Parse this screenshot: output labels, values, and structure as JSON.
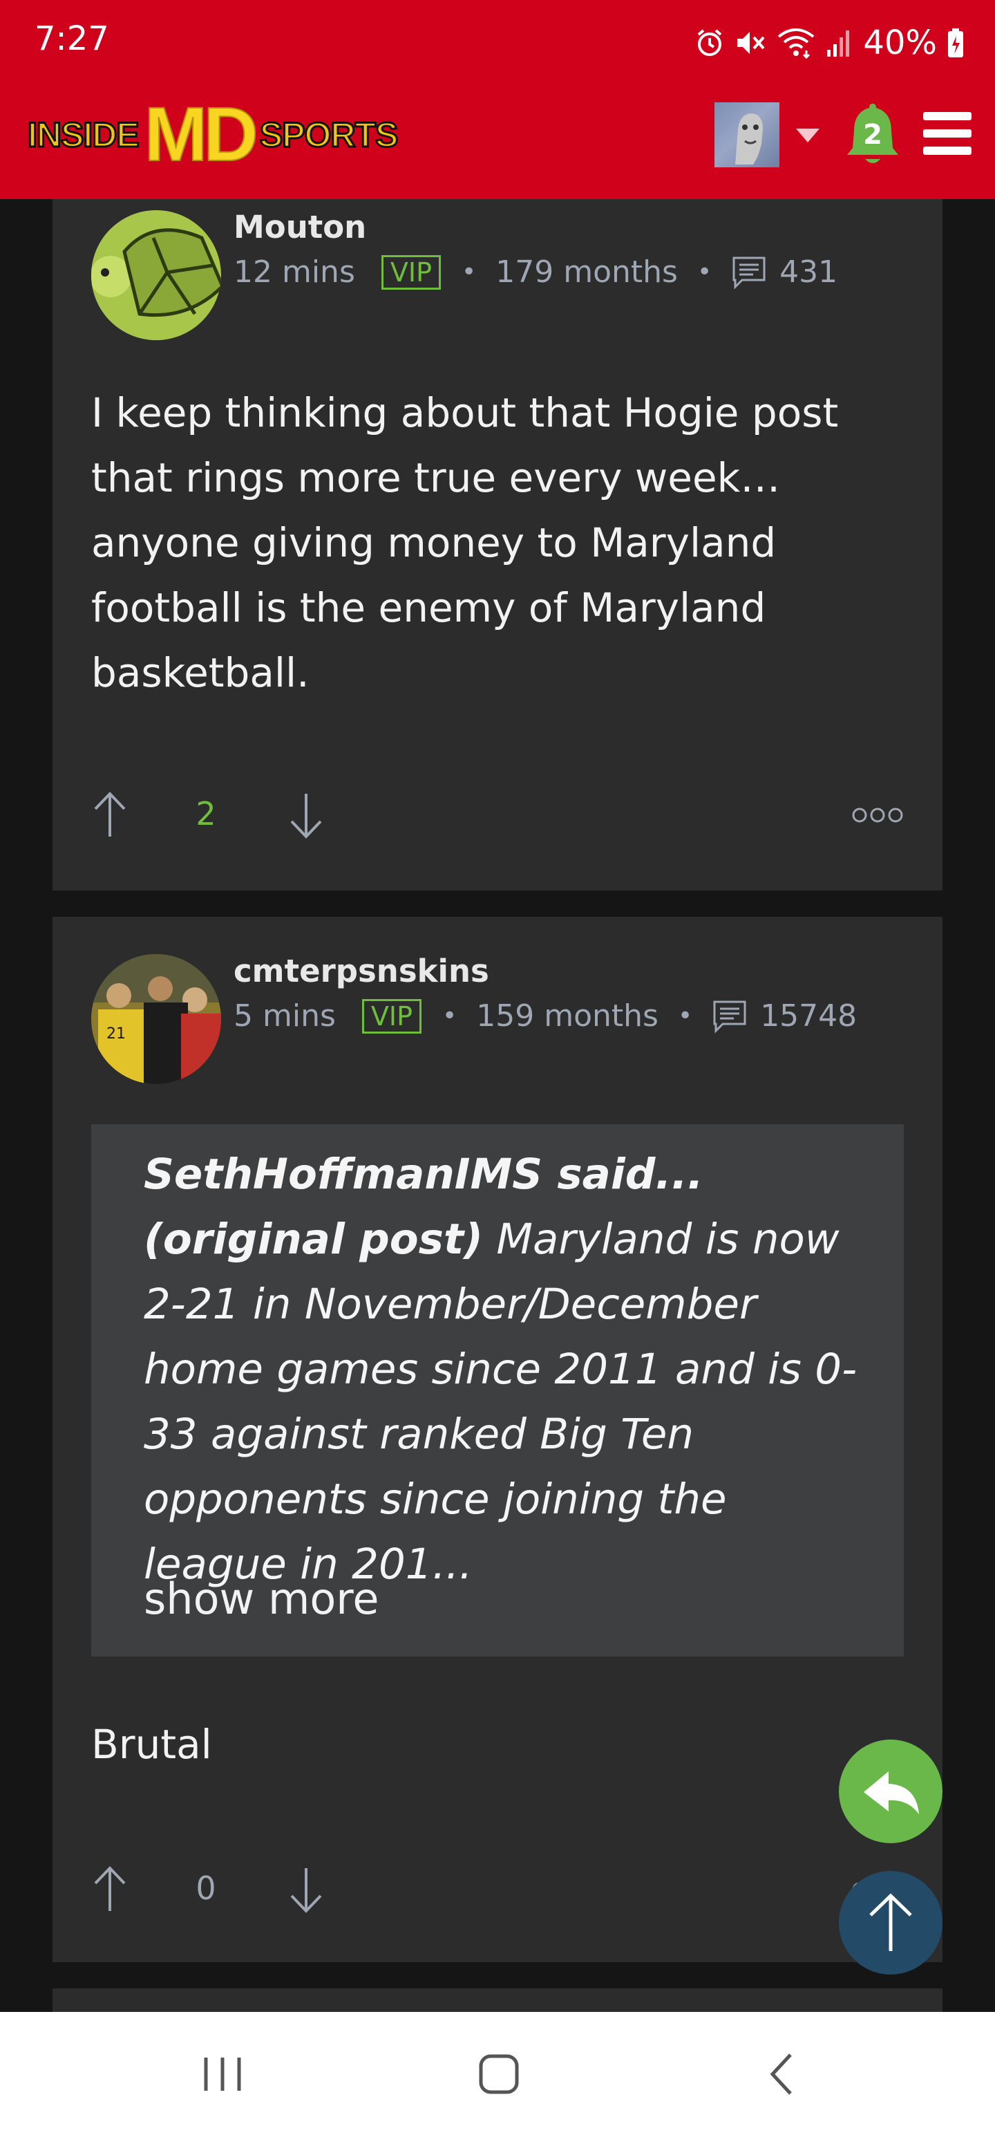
{
  "status_bar": {
    "time": "7:27",
    "battery": "40%",
    "icons": [
      "alarm-icon",
      "mute-icon",
      "wifi-icon",
      "signal-icon",
      "battery-icon"
    ]
  },
  "header": {
    "logo": {
      "part1": "INSIDE",
      "part2": "MD",
      "part3": "SPORTS"
    },
    "notification_count": "2",
    "colors": {
      "brand_red": "#d0021b",
      "logo_yellow": "#f7d520",
      "bell_green": "#6ab84a"
    }
  },
  "posts": [
    {
      "username": "Mouton",
      "time": "12 mins",
      "badge": "VIP",
      "tenure": "179 months",
      "post_count": "431",
      "body": "I keep thinking about that Hogie post that rings more true every week…anyone giving money to Maryland football is the enemy of Maryland basketball.",
      "votes": "2"
    },
    {
      "username": "cmterpsnskins",
      "time": "5 mins",
      "badge": "VIP",
      "tenure": "159 months",
      "post_count": "15748",
      "quote": {
        "attribution": "SethHoffmanIMS said... (original post)",
        "text": " Maryland is now 2-21 in November/December home games since 2011 and is 0-33 against ranked Big Ten opponents since joining the league in 201...",
        "show_more": "show more"
      },
      "body": "Brutal",
      "votes": "0"
    }
  ],
  "colors": {
    "vip_green": "#6fbf3a",
    "post_bg": "#2c2c2c",
    "quote_bg": "#3e3f41",
    "meta_gray": "#9ea7b3",
    "fab_reply": "#6ab84a",
    "fab_top": "#234a66"
  }
}
